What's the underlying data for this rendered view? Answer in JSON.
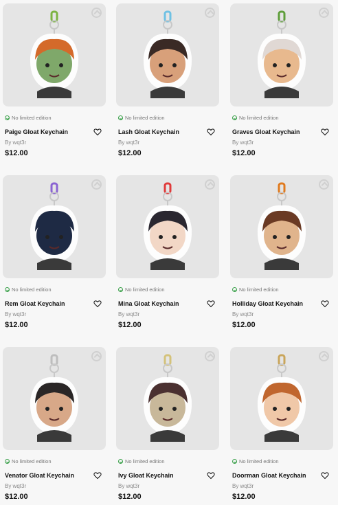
{
  "products": [
    {
      "name": "Paige Gloat Keychain",
      "by": "By wqt3r",
      "price": "$12.00",
      "edition": "No limited edition",
      "ring_color": "#7cb342",
      "hair_color": "#d46a2a",
      "skin_color": "#7fa86a"
    },
    {
      "name": "Lash Gloat Keychain",
      "by": "By wqt3r",
      "price": "$12.00",
      "edition": "No limited edition",
      "ring_color": "#6ec1e4",
      "hair_color": "#3a2a25",
      "skin_color": "#d8a07a"
    },
    {
      "name": "Graves Gloat Keychain",
      "by": "By wqt3r",
      "price": "$12.00",
      "edition": "No limited edition",
      "ring_color": "#5e9e3a",
      "hair_color": "#e0d8d4",
      "skin_color": "#e8b98e"
    },
    {
      "name": "Rem Gloat Keychain",
      "by": "By wqt3r",
      "price": "$12.00",
      "edition": "No limited edition",
      "ring_color": "#8a63d2",
      "hair_color": "#1e2a44",
      "skin_color": "#1e2a44"
    },
    {
      "name": "Mina Gloat Keychain",
      "by": "By wqt3r",
      "price": "$12.00",
      "edition": "No limited edition",
      "ring_color": "#e03a3a",
      "hair_color": "#2a2730",
      "skin_color": "#f2d7c6"
    },
    {
      "name": "Holliday Gloat Keychain",
      "by": "By wqt3r",
      "price": "$12.00",
      "edition": "No limited edition",
      "ring_color": "#e07a1e",
      "hair_color": "#6a3a24",
      "skin_color": "#e0b48c"
    },
    {
      "name": "Venator Gloat Keychain",
      "by": "By wqt3r",
      "price": "$12.00",
      "edition": "No limited edition",
      "ring_color": "#bdbdbd",
      "hair_color": "#2a2626",
      "skin_color": "#d8a888"
    },
    {
      "name": "Ivy Gloat Keychain",
      "by": "By wqt3r",
      "price": "$12.00",
      "edition": "No limited edition",
      "ring_color": "#d4c27a",
      "hair_color": "#4a3030",
      "skin_color": "#c8b89a"
    },
    {
      "name": "Doorman Gloat Keychain",
      "by": "By wqt3r",
      "price": "$12.00",
      "edition": "No limited edition",
      "ring_color": "#c9a55a",
      "hair_color": "#c0662e",
      "skin_color": "#f0c8a8"
    }
  ],
  "icons": {
    "edition": "check-circle-icon",
    "favorite": "heart-icon",
    "badge": "brand-badge-icon"
  }
}
